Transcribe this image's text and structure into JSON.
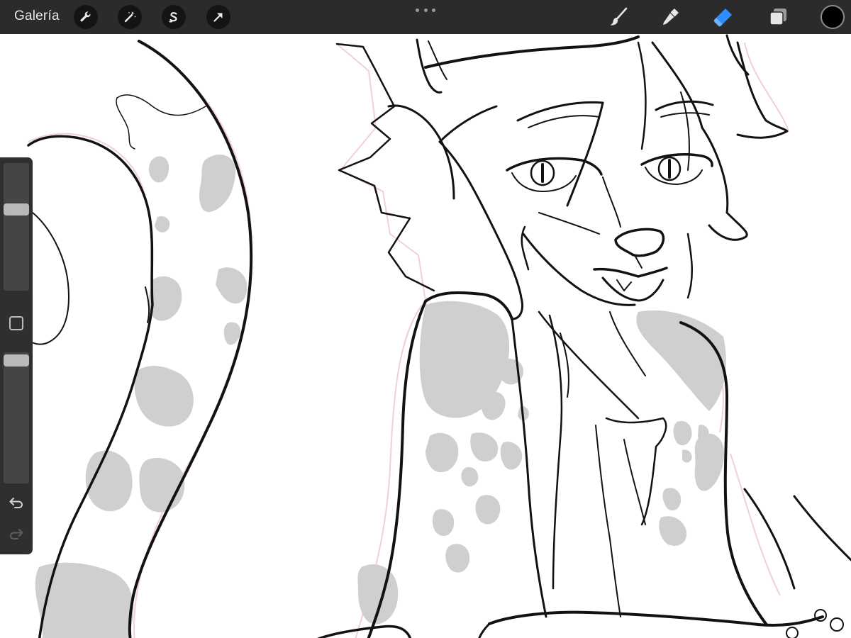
{
  "toolbar": {
    "gallery_label": "Galería",
    "left_tools": [
      "wrench-icon",
      "magic-wand-icon",
      "selection-icon",
      "transform-arrow-icon"
    ],
    "right_tools": [
      "brush-icon",
      "smudge-icon",
      "eraser-icon",
      "layers-icon"
    ],
    "active_tool": "eraser",
    "current_color": "#000000",
    "active_color": "#2f8cff"
  },
  "sidebar": {
    "brush_size_level": 0.65,
    "opacity_level": 0.98,
    "controls": [
      "modify-button",
      "undo-icon",
      "redo-icon"
    ]
  },
  "colors": {
    "toolbar_bg": "#2b2b2b",
    "sidebar_bg": "#2f2f2f",
    "line": "#121212",
    "spot": "#cfcfcf",
    "sketch": "#e9b9c0"
  }
}
